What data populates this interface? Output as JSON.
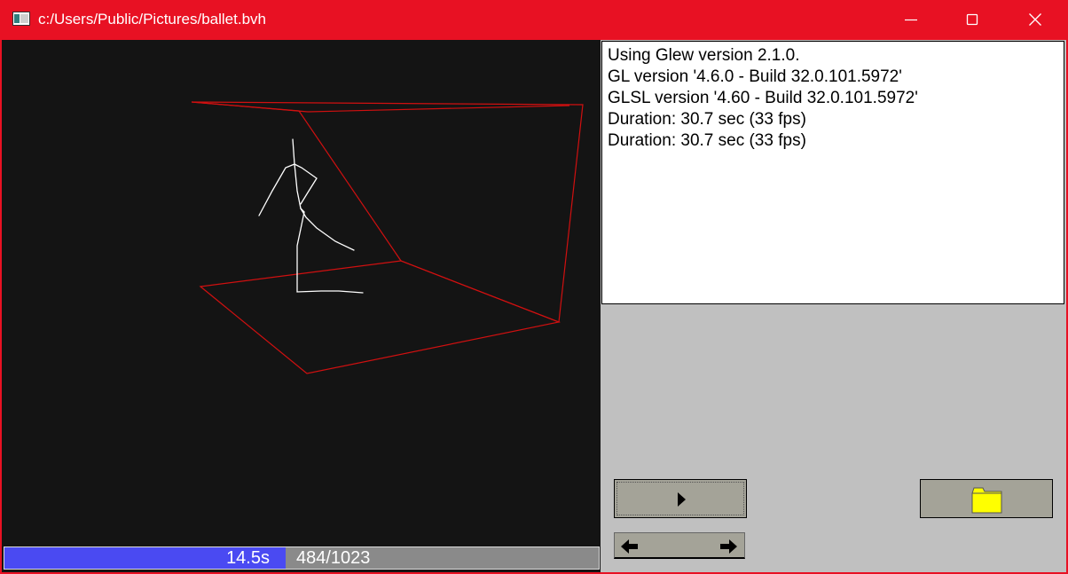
{
  "window": {
    "title": "c:/Users/Public/Pictures/ballet.bvh",
    "controls": {
      "minimize_icon": "minimize-icon",
      "maximize_icon": "maximize-icon",
      "close_icon": "close-icon"
    }
  },
  "viewport": {
    "background": "#141414",
    "bounding_box_color": "#d01010",
    "skeleton_color": "#ffffff"
  },
  "playback": {
    "time_label": "14.5s",
    "frame_label": "484/1023",
    "current_frame": 484,
    "total_frames": 1023,
    "fill_color": "#4a4af2"
  },
  "log": {
    "lines": [
      "Using Glew version 2.1.0.",
      "GL version '4.6.0 - Build 32.0.101.5972'",
      "GLSL version '4.60 - Build 32.0.101.5972'",
      "Duration: 30.7 sec (33 fps)",
      "Duration: 30.7 sec (33 fps)"
    ]
  },
  "controls": {
    "play_icon": "play-icon",
    "open_icon": "folder-icon",
    "step_back_icon": "arrow-left-icon",
    "step_forward_icon": "arrow-right-icon"
  }
}
